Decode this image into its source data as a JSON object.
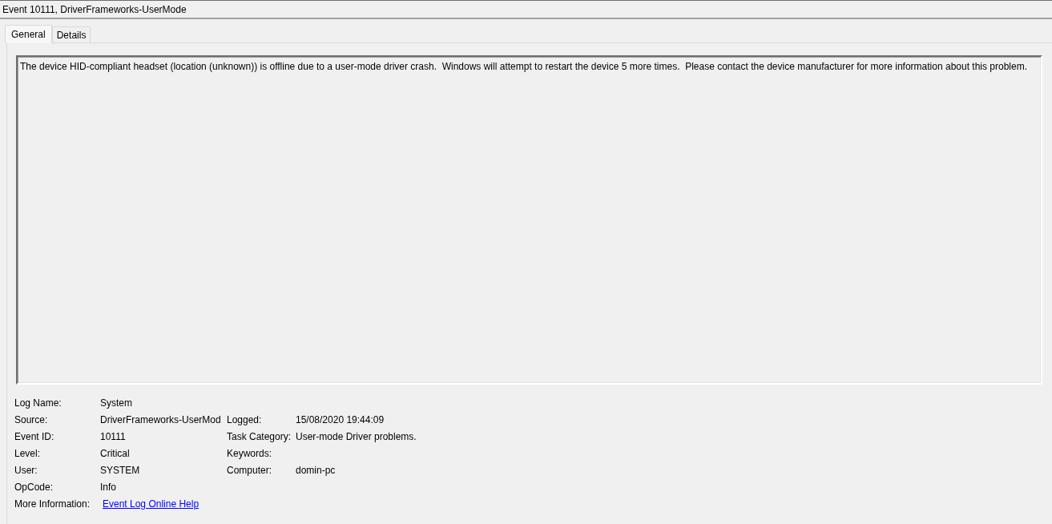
{
  "window": {
    "title": "Event 10111, DriverFrameworks-UserMode"
  },
  "tabs": [
    {
      "label": "General",
      "selected": true
    },
    {
      "label": "Details",
      "selected": false
    }
  ],
  "description": "The device HID-compliant headset (location (unknown)) is offline due to a user-mode driver crash.  Windows will attempt to restart the device 5 more times.  Please contact the device manufacturer for more information about this problem.",
  "properties": [
    {
      "label": "Log Name:",
      "value": "System"
    },
    {
      "label": "Source:",
      "value": "DriverFrameworks-UserMod",
      "right": {
        "label": "Logged:",
        "value": "15/08/2020 19:44:09"
      }
    },
    {
      "label": "Event ID:",
      "value": "10111",
      "right": {
        "label": "Task Category:",
        "value": "User-mode Driver problems."
      }
    },
    {
      "label": "Level:",
      "value": "Critical",
      "right": {
        "label": "Keywords:"
      }
    },
    {
      "label": "User:",
      "value": "SYSTEM",
      "right": {
        "label": "Computer:",
        "value": "domin-pc"
      }
    },
    {
      "label": "OpCode:",
      "value": "Info"
    },
    {
      "label": "More Information:",
      "link": "Event Log Online Help"
    }
  ]
}
